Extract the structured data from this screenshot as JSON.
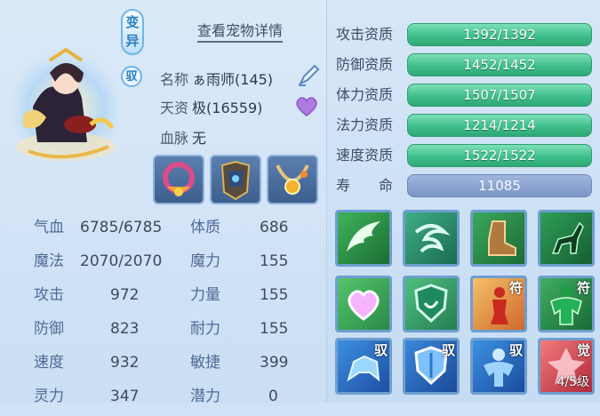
{
  "pet": {
    "mutation_badge": "变异",
    "ride_badge": "驭",
    "detail_link": "查看宠物详情",
    "name_label": "名称",
    "name_value": "ぁ雨师(145)",
    "aptitude_label": "天资",
    "aptitude_value": "极(16559)",
    "bloodline_label": "血脉",
    "bloodline_value": "无"
  },
  "equipment": [
    {
      "name": "collar"
    },
    {
      "name": "armor"
    },
    {
      "name": "necklace"
    }
  ],
  "stats": {
    "left": [
      {
        "label": "气血",
        "value": "6785/6785"
      },
      {
        "label": "魔法",
        "value": "2070/2070"
      },
      {
        "label": "攻击",
        "value": "972"
      },
      {
        "label": "防御",
        "value": "823"
      },
      {
        "label": "速度",
        "value": "932"
      },
      {
        "label": "灵力",
        "value": "347"
      }
    ],
    "right": [
      {
        "label": "体质",
        "value": "686"
      },
      {
        "label": "魔力",
        "value": "155"
      },
      {
        "label": "力量",
        "value": "155"
      },
      {
        "label": "耐力",
        "value": "155"
      },
      {
        "label": "敏捷",
        "value": "399"
      },
      {
        "label": "潜力",
        "value": "0"
      }
    ]
  },
  "qualities": [
    {
      "label": "攻击资质",
      "value": "1392/1392"
    },
    {
      "label": "防御资质",
      "value": "1452/1452"
    },
    {
      "label": "体力资质",
      "value": "1507/1507"
    },
    {
      "label": "法力资质",
      "value": "1214/1214"
    },
    {
      "label": "速度资质",
      "value": "1522/1522"
    },
    {
      "label": "寿　　命",
      "value": "11085"
    }
  ],
  "skills": {
    "row1": [
      "wing-skill-icon",
      "whirlwind-skill-icon",
      "boot-skill-icon",
      "deer-skill-icon"
    ],
    "row2_corners": [
      "",
      "",
      "符",
      "符"
    ],
    "row3_corners": [
      "驭",
      "驭",
      "驭",
      "觉"
    ],
    "awaken_level": "4/5级"
  },
  "colors": {
    "accent_green": "#3fbf8c",
    "life_bar": "#7b95c6",
    "link_text": "#3d4f66"
  }
}
